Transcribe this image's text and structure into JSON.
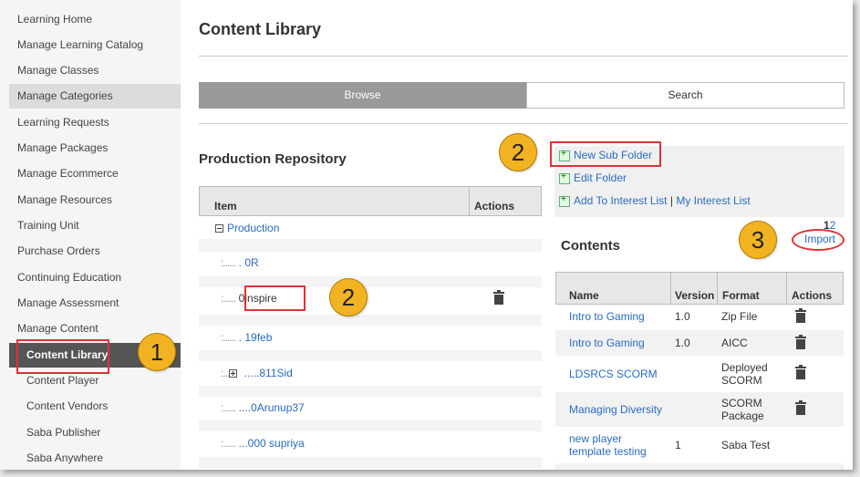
{
  "sidebar": {
    "items": [
      {
        "label": "Learning Home"
      },
      {
        "label": "Manage Learning Catalog"
      },
      {
        "label": "Manage Classes"
      },
      {
        "label": "Manage Categories"
      },
      {
        "label": "Learning Requests"
      },
      {
        "label": "Manage Packages"
      },
      {
        "label": "Manage Ecommerce"
      },
      {
        "label": "Manage Resources"
      },
      {
        "label": "Training Unit"
      },
      {
        "label": "Purchase Orders"
      },
      {
        "label": "Continuing Education"
      },
      {
        "label": "Manage Assessment"
      },
      {
        "label": "Manage Content"
      },
      {
        "label": "Content Library"
      },
      {
        "label": "Content Player"
      },
      {
        "label": "Content Vendors"
      },
      {
        "label": "Saba Publisher"
      },
      {
        "label": "Saba Anywhere"
      }
    ]
  },
  "page": {
    "title": "Content Library"
  },
  "tabs": {
    "browse": "Browse",
    "search": "Search"
  },
  "repository": {
    "title": "Production Repository",
    "col_item": "Item",
    "col_actions": "Actions",
    "root": "Production",
    "nodes": [
      {
        "prefix": ":......",
        "label": " . 0R"
      },
      {
        "prefix": ":......",
        "label": " 0inspire"
      },
      {
        "prefix": ":......",
        "label": " . 19feb"
      },
      {
        "prefix": ":...",
        "label": " .....811Sid"
      },
      {
        "prefix": ":......",
        "label": " ....0Arunup37"
      },
      {
        "prefix": ":......",
        "label": " ...000   supriya"
      }
    ]
  },
  "links": {
    "new_sub_folder": "New Sub Folder",
    "edit_folder": "Edit Folder",
    "add_to_interest": "Add To Interest List",
    "separator": "|",
    "my_interest": "My Interest List"
  },
  "contents": {
    "title": "Contents",
    "pager_current": "1",
    "pager_next": "2",
    "import": "Import",
    "headers": {
      "name": "Name",
      "version": "Version",
      "format": "Format",
      "actions": "Actions"
    },
    "rows": [
      {
        "name": "Intro to Gaming",
        "version": "1.0",
        "format": "Zip File"
      },
      {
        "name": "Intro to Gaming",
        "version": "1.0",
        "format": "AICC"
      },
      {
        "name": "LDSRCS SCORM",
        "version": "",
        "format": "Deployed SCORM"
      },
      {
        "name": "Managing Diversity",
        "version": "",
        "format": "SCORM Package"
      },
      {
        "name": "new player template testing",
        "version": "1",
        "format": "Saba Test"
      }
    ]
  },
  "callouts": {
    "one": "1",
    "two_a": "2",
    "two_b": "2",
    "three": "3"
  },
  "colors": {
    "accent_callout": "#f2b322",
    "highlight_box": "#dd3333",
    "link": "#2b6bbf",
    "active_nav": "#555555"
  }
}
